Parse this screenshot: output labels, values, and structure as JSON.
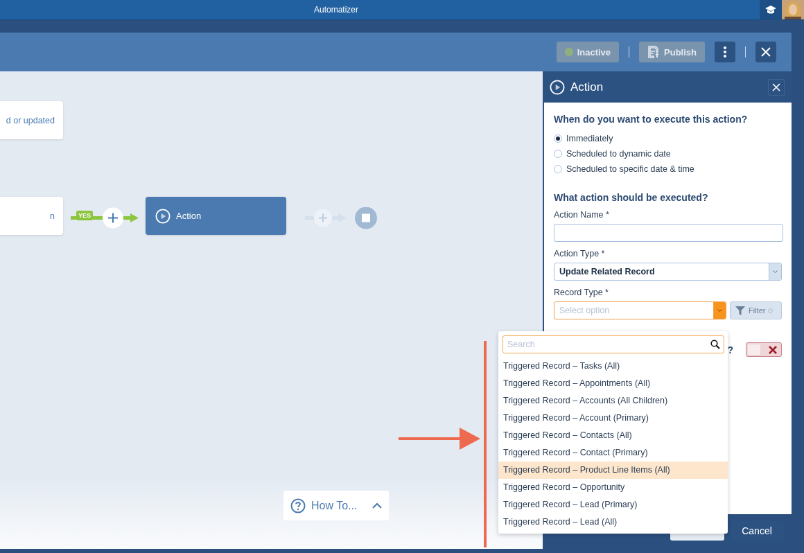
{
  "app": {
    "title": "Automatizer"
  },
  "toolbar": {
    "buttons": [
      {
        "label": "Inactive",
        "kind": "status",
        "disabled": true
      },
      {
        "label": "Publish",
        "kind": "publish",
        "disabled": true
      }
    ]
  },
  "canvas": {
    "nodes": [
      {
        "text": "d or updated",
        "kind": "trigger"
      },
      {
        "text": "n",
        "kind": "condition"
      },
      {
        "text": "Action",
        "kind": "action"
      }
    ],
    "branch_label": "YES",
    "help": {
      "label": "How To..."
    }
  },
  "panel": {
    "title": "Action",
    "question1": "When do you want to execute this action?",
    "timing": [
      {
        "label": "Immediately",
        "selected": true
      },
      {
        "label": "Scheduled to dynamic date",
        "selected": false
      },
      {
        "label": "Scheduled to specific date & time",
        "selected": false
      }
    ],
    "question2": "What action should be executed?",
    "fields": [
      {
        "label": "Action Name *",
        "kind": "text"
      },
      {
        "label": "Action Type *",
        "kind": "select",
        "value": "Update Related Record",
        "open": false
      },
      {
        "label": "Record Type *",
        "kind": "select",
        "placeholder": "Select option",
        "open": true
      }
    ],
    "filter": "Filter",
    "partial_label": "?",
    "toggle_on": false,
    "cancel": "Cancel"
  },
  "dropdown": {
    "search_placeholder": "Search",
    "options": [
      {
        "label": "Triggered Record – Tasks (All)",
        "selected": false
      },
      {
        "label": "Triggered Record – Appointments (All)",
        "selected": false
      },
      {
        "label": "Triggered Record – Accounts (All Children)",
        "selected": false
      },
      {
        "label": "Triggered Record – Account (Primary)",
        "selected": false
      },
      {
        "label": "Triggered Record – Contacts (All)",
        "selected": false
      },
      {
        "label": "Triggered Record – Contact (Primary)",
        "selected": false
      },
      {
        "label": "Triggered Record – Product Line Items (All)",
        "selected": true
      },
      {
        "label": "Triggered Record – Opportunity",
        "selected": false
      },
      {
        "label": "Triggered Record – Lead (Primary)",
        "selected": false
      },
      {
        "label": "Triggered Record – Lead (All)",
        "selected": false
      }
    ]
  }
}
